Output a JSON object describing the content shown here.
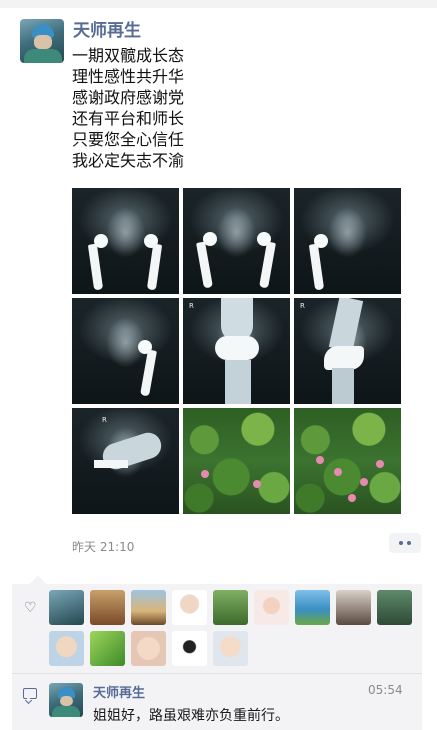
{
  "post": {
    "author": "天师再生",
    "lines": [
      "一期双髋成长态",
      "理性感性共升华",
      "感谢政府感谢党",
      "还有平台和师长",
      "只要您全心信任",
      "我必定矢志不渝"
    ],
    "time": "昨天 21:10",
    "xray_marker": "R"
  },
  "likes": {
    "icon": "heart-outline-icon",
    "count": 13
  },
  "comment": {
    "author": "天师再生",
    "time": "05:54",
    "text": "姐姐好，路虽艰难亦负重前行。"
  },
  "colors": {
    "link_blue": "#576b95",
    "panel_bg": "#f3f3f5",
    "meta_gray": "#8a8a8a"
  }
}
